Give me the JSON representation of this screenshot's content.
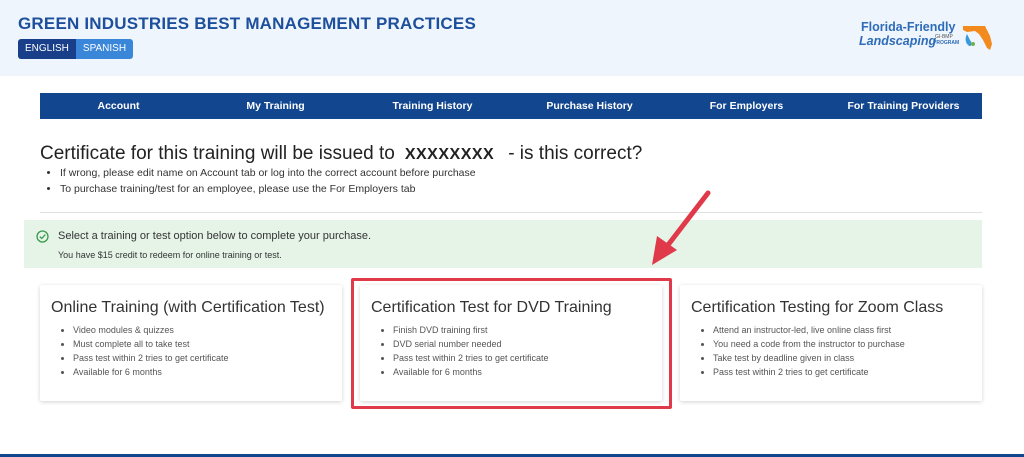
{
  "header": {
    "title": "GREEN INDUSTRIES BEST MANAGEMENT PRACTICES",
    "languages": [
      "ENGLISH",
      "SPANISH"
    ],
    "logo": {
      "line1": "Florida-Friendly",
      "line2": "Landscaping",
      "tm": "GI-BMP",
      "program": "PROGRAM"
    }
  },
  "nav": {
    "items": [
      "Account",
      "My Training",
      "Training History",
      "Purchase History",
      "For Employers",
      "For Training Providers"
    ]
  },
  "confirm": {
    "prefix": "Certificate for this training will be issued to",
    "name": "XXXXXXXX",
    "suffix": "- is this correct?",
    "hints": [
      "If wrong, please edit name on Account tab or log into the correct account before purchase",
      "To purchase training/test for an employee, please use the For Employers tab"
    ]
  },
  "alert": {
    "message": "Select a training or test option below to complete your purchase.",
    "credit": "You have $15 credit to redeem for online training or test."
  },
  "cards": [
    {
      "title": "Online Training (with Certification Test)",
      "bullets": [
        "Video modules & quizzes",
        "Must complete all to take test",
        "Pass test within 2 tries to get certificate",
        "Available for 6 months"
      ]
    },
    {
      "title": "Certification Test for DVD Training",
      "bullets": [
        "Finish DVD training first",
        "DVD serial number needed",
        "Pass test within 2 tries to get certificate",
        "Available for 6 months"
      ]
    },
    {
      "title": "Certification Testing for Zoom Class",
      "bullets": [
        "Attend an instructor-led, live online class first",
        "You need a code from the instructor to purchase",
        "Take test by deadline given in class",
        "Pass test within 2 tries to get certificate"
      ]
    }
  ],
  "colors": {
    "brand_blue": "#12468f",
    "title_blue": "#1d4f9c",
    "alert_bg": "#e6f4e8",
    "highlight_red": "#e0394a"
  }
}
